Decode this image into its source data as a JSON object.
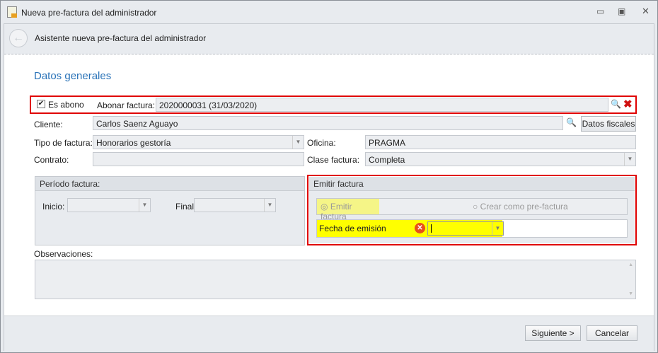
{
  "window": {
    "title": "Nueva pre-factura del administrador"
  },
  "header": {
    "title": "Asistente nueva pre-factura del administrador"
  },
  "section_title": "Datos generales",
  "abono": {
    "checkbox_label": "Es abono",
    "checked": true,
    "abonar_label": "Abonar factura:",
    "abonar_value": "2020000031 (31/03/2020)"
  },
  "cliente": {
    "label": "Cliente:",
    "value": "Carlos Saenz Aguayo",
    "fiscal_button": "Datos fiscales"
  },
  "tipo": {
    "label": "Tipo de factura:",
    "value": "Honorarios gestoría"
  },
  "oficina": {
    "label": "Oficina:",
    "value": "PRAGMA"
  },
  "contrato": {
    "label": "Contrato:",
    "value": ""
  },
  "clase": {
    "label": "Clase factura:",
    "value": "Completa"
  },
  "periodo": {
    "title": "Período factura:",
    "inicio_label": "Inicio:",
    "final_label": "Final:"
  },
  "emitir": {
    "title": "Emitir factura",
    "option1": "Emitir factura",
    "option2": "Crear como pre-factura",
    "fecha_label": "Fecha de emisión"
  },
  "observaciones": {
    "label": "Observaciones:"
  },
  "footer": {
    "next": "Siguiente >",
    "cancel": "Cancelar"
  }
}
